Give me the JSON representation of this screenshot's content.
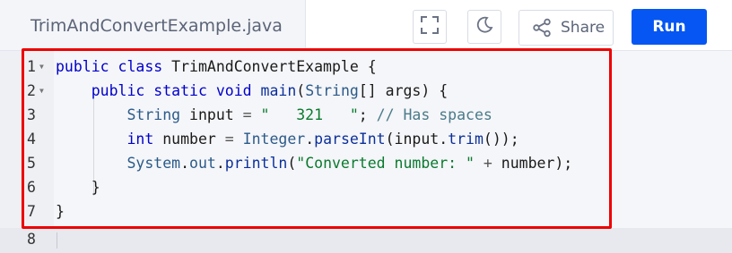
{
  "header": {
    "file_name": "TrimAndConvertExample.java",
    "share_label": "Share",
    "run_label": "Run",
    "icons": [
      "fullscreen-icon",
      "moon-icon",
      "share-icon"
    ]
  },
  "editor": {
    "lines": [
      {
        "num": "1",
        "code": "public class TrimAndConvertExample {"
      },
      {
        "num": "2",
        "code": "    public static void main(String[] args) {"
      },
      {
        "num": "3",
        "code": "        String input = \"   321   \"; // Has spaces"
      },
      {
        "num": "4",
        "code": "        int number = Integer.parseInt(input.trim());"
      },
      {
        "num": "5",
        "code": "        System.out.println(\"Converted number: \" + number);"
      },
      {
        "num": "6",
        "code": "    }"
      },
      {
        "num": "7",
        "code": "}"
      },
      {
        "num": "8",
        "code": ""
      }
    ]
  },
  "colors": {
    "run_button": "#0556f3",
    "highlight_border": "#ee0000",
    "keyword": "#0000cc",
    "string": "#0a7a2f",
    "comment": "#4a7a8a"
  }
}
